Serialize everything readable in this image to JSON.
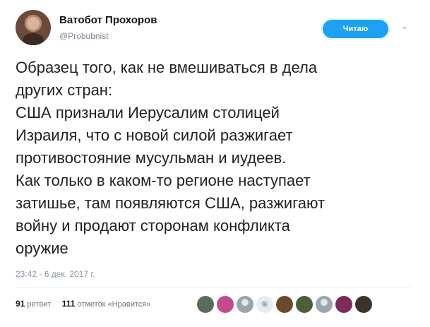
{
  "author": {
    "name": "Ватобот Прохоров",
    "handle": "@Probubnist"
  },
  "follow_button_label": "Читаю",
  "menu_icon": "chevron-down-icon",
  "tweet": {
    "text": "Образец того, как не вмешиваться в дела\nдругих стран:\nСША признали Иерусалим столицей\nИзраиля, что с новой силой разжигает\nпротивостояние мусульман и иудеев.\nКак только в каком-то регионе наступает\nзатишье, там появляются США, разжигают\nвойну и продают сторонам конфликта\nоружие",
    "timestamp": "23:42 - 6 дек. 2017 г."
  },
  "stats": {
    "retweets_count": "91",
    "retweets_label": "ретвит",
    "likes_count": "111",
    "likes_label": "отметок «Нравится»"
  },
  "likers": [
    {
      "icon": "avatar",
      "color": "#5a6b5e"
    },
    {
      "icon": "avatar",
      "color": "#c24a8e"
    },
    {
      "icon": "default-egg-avatar",
      "color": "#9aa5ae"
    },
    {
      "icon": "dove-avatar",
      "color": "#e9ecef"
    },
    {
      "icon": "avatar",
      "color": "#6b4a2b"
    },
    {
      "icon": "avatar",
      "color": "#4c5f3a"
    },
    {
      "icon": "default-egg-avatar",
      "color": "#9aa5ae"
    },
    {
      "icon": "avatar",
      "color": "#7d2b5c"
    },
    {
      "icon": "avatar",
      "color": "#3e3229"
    }
  ]
}
